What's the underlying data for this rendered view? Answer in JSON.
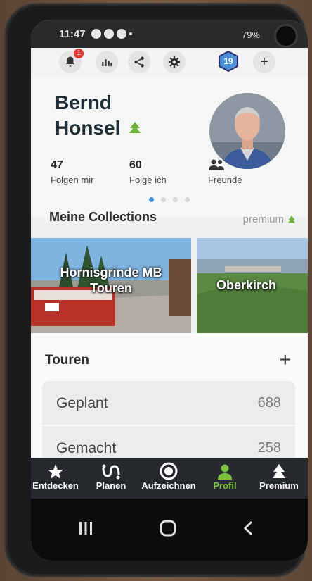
{
  "status_bar": {
    "time": "11:47",
    "battery": "79%"
  },
  "toolbar": {
    "notification_count": "1",
    "level": "19"
  },
  "profile": {
    "first_name": "Bernd",
    "last_name": "Honsel",
    "stats": [
      {
        "value": "47",
        "label": "Folgen mir"
      },
      {
        "value": "60",
        "label": "Folge ich"
      },
      {
        "value": "",
        "label": "Freunde"
      }
    ]
  },
  "collections": {
    "title": "Meine Collections",
    "premium_label": "premium",
    "cards": [
      {
        "title_line1": "Hornisgrinde MB",
        "title_line2": "Touren"
      },
      {
        "title_line1": "Oberkirch",
        "title_line2": ""
      }
    ]
  },
  "touren": {
    "title": "Touren",
    "rows": [
      {
        "label": "Geplant",
        "value": "688"
      },
      {
        "label": "Gemacht",
        "value": "258"
      }
    ]
  },
  "bottom_nav": {
    "items": [
      {
        "label": "Entdecken",
        "icon": "star-icon"
      },
      {
        "label": "Planen",
        "icon": "route-icon"
      },
      {
        "label": "Aufzeichnen",
        "icon": "record-icon"
      },
      {
        "label": "Profil",
        "icon": "person-icon"
      },
      {
        "label": "Premium",
        "icon": "tree-icon"
      }
    ],
    "active_index": 3
  },
  "colors": {
    "accent_green": "#7ec242",
    "brand_dark": "#1f2d36",
    "badge_red": "#e53935",
    "level_blue": "#4a90d9"
  }
}
